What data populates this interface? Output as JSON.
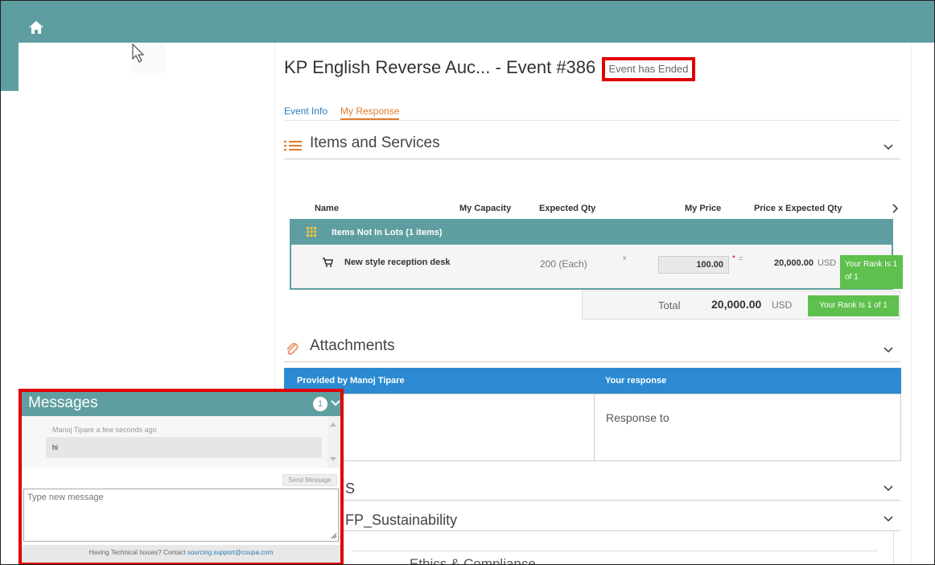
{
  "header": {
    "home_icon": "home-icon"
  },
  "event": {
    "title": "KP English Reverse Auc... - Event #386",
    "status": "Event has Ended"
  },
  "tabs": [
    {
      "label": "Event Info",
      "active": false
    },
    {
      "label": "My Response",
      "active": true
    }
  ],
  "items_section": {
    "title": "Items and Services",
    "columns": [
      "Name",
      "My Capacity",
      "Expected Qty",
      "My Price",
      "Price x Expected Qty"
    ],
    "group_label": "Items Not In Lots (1 items)",
    "item": {
      "name": "New style reception desk",
      "capacity": "200 (Each)",
      "mult_symbol": "x",
      "price": "100.00",
      "required": "*",
      "eq_symbol": "=",
      "line_total": "20,000.00",
      "currency": "USD",
      "rank": "Your Rank Is 1 of 1"
    },
    "total": {
      "label": "Total",
      "value": "20,000.00",
      "currency": "USD",
      "rank": "Your Rank Is 1 of 1"
    }
  },
  "attachments": {
    "title": "Attachments",
    "col_provided": "Provided by Manoj Tipare",
    "col_response": "Your response",
    "response_text": "Response to"
  },
  "section3": {
    "label_visible": "S"
  },
  "section4": {
    "label_visible": "FP_Sustainability"
  },
  "subsection": {
    "label_visible": "Ethics & Compliance"
  },
  "messages": {
    "title": "Messages",
    "unread_count": "1",
    "items": [
      {
        "sender_time": "Manoj Tipare a few seconds ago",
        "text": "hi"
      }
    ],
    "send_label": "Send Message",
    "input_placeholder": "Type new message",
    "footer_text": "Having Technical Issues? Contact ",
    "footer_link": "sourcing.support@coupa.com"
  },
  "colors": {
    "teal": "#5f9ea0",
    "blue_header": "#2b8ad1",
    "rank_green": "#5ec04d",
    "highlight_red": "#e10000",
    "tab_orange": "#e07c2c"
  }
}
